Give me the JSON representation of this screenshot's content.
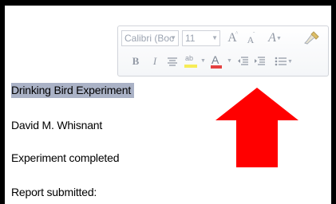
{
  "document": {
    "lines": [
      "Drinking Bird Experiment",
      "David M. Whisnant",
      "Experiment completed",
      "Report submitted:"
    ]
  },
  "mini_toolbar": {
    "font_name": "Calibri (Boc",
    "font_size": "11",
    "grow_label": "A",
    "shrink_label": "A",
    "styles_label": "A",
    "bold_label": "B",
    "italic_label": "I",
    "highlight_label": "ab",
    "font_color_label": "A",
    "highlight_color": "#f5e93a",
    "font_color": "#e02020"
  },
  "colors": {
    "selection": "#aab2c6",
    "arrow": "#ff0000"
  }
}
